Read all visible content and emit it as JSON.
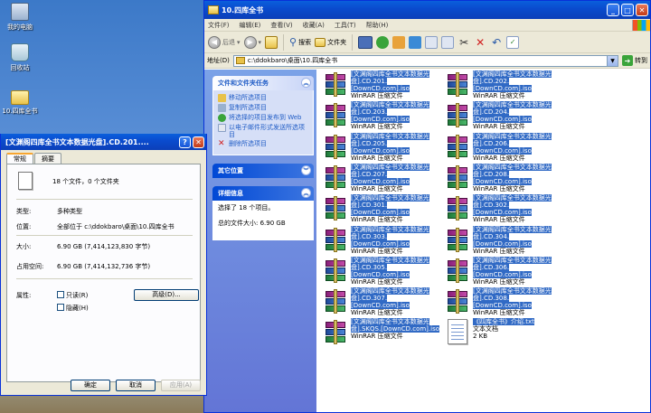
{
  "desktop": {
    "icons": [
      {
        "label": "我的电脑",
        "type": "computer"
      },
      {
        "label": "回收站",
        "type": "recycle"
      },
      {
        "label": "10.四库全书",
        "type": "folder"
      }
    ]
  },
  "explorer": {
    "title": "10.四库全书",
    "menu": [
      "文件(F)",
      "编辑(E)",
      "查看(V)",
      "收藏(A)",
      "工具(T)",
      "帮助(H)"
    ],
    "toolbar": {
      "back": "后退",
      "search": "搜索",
      "folders": "文件夹"
    },
    "address": {
      "label": "地址(D)",
      "value": "c:\\ddokbaro\\桌面\\10.四库全书",
      "go": "转到"
    },
    "taskpane": {
      "file_tasks": {
        "title": "文件和文件夹任务",
        "items": [
          "移动所选项目",
          "复制所选项目",
          "将选择的项目发布到 Web",
          "以电子邮件形式发送所选项目",
          "删除所选项目"
        ]
      },
      "other_places": {
        "title": "其它位置"
      },
      "details": {
        "title": "详细信息",
        "selected": "选择了 18 个项目。",
        "total": "总的文件大小: 6.90 GB"
      }
    },
    "files": [
      {
        "name1": "[文渊阁四库全书文本数据光",
        "name2": "盘].CD.201.[DownCD.com].iso",
        "type": "WinRAR 压缩文件"
      },
      {
        "name1": "[文渊阁四库全书文本数据光",
        "name2": "盘].CD.202.[DownCD.com].iso",
        "type": "WinRAR 压缩文件"
      },
      {
        "name1": "[文渊阁四库全书文本数据光",
        "name2": "盘].CD.203.[DownCD.com].iso",
        "type": "WinRAR 压缩文件"
      },
      {
        "name1": "[文渊阁四库全书文本数据光",
        "name2": "盘].CD.204.[DownCD.com].iso",
        "type": "WinRAR 压缩文件"
      },
      {
        "name1": "[文渊阁四库全书文本数据光",
        "name2": "盘].CD.205.[DownCD.com].iso",
        "type": "WinRAR 压缩文件"
      },
      {
        "name1": "[文渊阁四库全书文本数据光",
        "name2": "盘].CD.206.[DownCD.com].iso",
        "type": "WinRAR 压缩文件"
      },
      {
        "name1": "[文渊阁四库全书文本数据光",
        "name2": "盘].CD.207.[DownCD.com].iso",
        "type": "WinRAR 压缩文件"
      },
      {
        "name1": "[文渊阁四库全书文本数据光",
        "name2": "盘].CD.208.[DownCD.com].iso",
        "type": "WinRAR 压缩文件"
      },
      {
        "name1": "[文渊阁四库全书文本数据光",
        "name2": "盘].CD.301.[DownCD.com].iso",
        "type": "WinRAR 压缩文件"
      },
      {
        "name1": "[文渊阁四库全书文本数据光",
        "name2": "盘].CD.302.[DownCD.com].iso",
        "type": "WinRAR 压缩文件"
      },
      {
        "name1": "[文渊阁四库全书文本数据光",
        "name2": "盘].CD.303.[DownCD.com].iso",
        "type": "WinRAR 压缩文件"
      },
      {
        "name1": "[文渊阁四库全书文本数据光",
        "name2": "盘].CD.304.[DownCD.com].iso",
        "type": "WinRAR 压缩文件"
      },
      {
        "name1": "[文渊阁四库全书文本数据光",
        "name2": "盘].CD.305.[DownCD.com].iso",
        "type": "WinRAR 压缩文件"
      },
      {
        "name1": "[文渊阁四库全书文本数据光",
        "name2": "盘].CD.306.[DownCD.com].iso",
        "type": "WinRAR 压缩文件"
      },
      {
        "name1": "[文渊阁四库全书文本数据光",
        "name2": "盘].CD.307.[DownCD.com].iso",
        "type": "WinRAR 压缩文件"
      },
      {
        "name1": "[文渊阁四库全书文本数据光",
        "name2": "盘].CD.308.[DownCD.com].iso",
        "type": "WinRAR 压缩文件"
      },
      {
        "name1": "[文渊阁四库全书文本数据光",
        "name2": "盘].SKQS.[DownCD.com].iso",
        "type": "WinRAR 压缩文件"
      }
    ],
    "textfile": {
      "name": "《四库全书》介绍.txt",
      "type": "文本文档",
      "size": "2 KB"
    }
  },
  "properties": {
    "title": "[文渊阁四库全书文本数据光盘].CD.201....",
    "tabs": [
      "常规",
      "摘要"
    ],
    "summary": "18 个文件，0 个文件夹",
    "rows": [
      {
        "k": "类型:",
        "v": "多种类型"
      },
      {
        "k": "位置:",
        "v": "全部位于 c:\\ddokbaro\\桌面\\10.四库全书"
      },
      {
        "k": "大小:",
        "v": "6.90 GB (7,414,123,830 字节)"
      },
      {
        "k": "占用空间:",
        "v": "6.90 GB (7,414,132,736 字节)"
      }
    ],
    "attr_label": "属性:",
    "readonly": "只读(R)",
    "hidden": "隐藏(H)",
    "advanced": "高级(D)...",
    "ok": "确定",
    "cancel": "取消",
    "apply": "应用(A)"
  }
}
